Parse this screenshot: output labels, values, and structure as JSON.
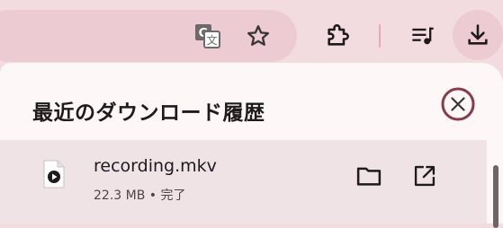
{
  "panel": {
    "title": "最近のダウンロード履歴"
  },
  "downloads": [
    {
      "file_name": "recording.mkv",
      "meta": "22.3 MB • 完了",
      "icon": "video-file-icon"
    }
  ],
  "toolbar_icons": [
    "translate-icon",
    "star-icon",
    "extensions-puzzle-icon",
    "media-playlist-icon",
    "download-icon"
  ],
  "colors": {
    "toolbar_bg": "#f3dce0",
    "panel_bg": "#fdf7f8",
    "row_hover": "#efe3e6",
    "close_ring": "#8b3a4a",
    "icon": "#1f1b1d"
  }
}
